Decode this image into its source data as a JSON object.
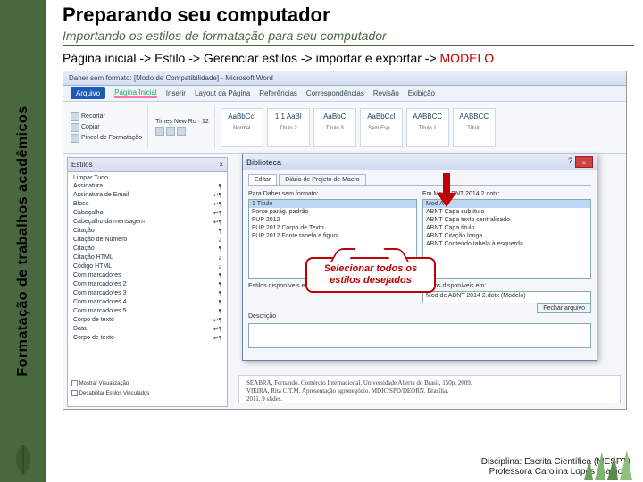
{
  "sidebar": {
    "vertical_text": "Formatação de trabalhos acadêmicos"
  },
  "header": {
    "title": "Preparando seu computador",
    "subtitle": "Importando os estilos de formatação para seu computador",
    "path_plain": "Página inicial -> Estilo -> Gerenciar estilos -> importar e exportar -> ",
    "path_red": "MODELO"
  },
  "word": {
    "window_title": "Daher sem formato: [Modo de Compatibilidade] - Microsoft Word",
    "file_tab": "Arquivo",
    "tabs": [
      "Página Inicial",
      "Inserir",
      "Layout da Página",
      "Referências",
      "Correspondências",
      "Revisão",
      "Exibição"
    ],
    "clipboard": {
      "cut": "Recortar",
      "copy": "Copiar",
      "brush": "Pincel de Formatação"
    },
    "font": "Times New Ro · 12",
    "style_samples": [
      {
        "a": "AaBbCcl",
        "b": "Normal"
      },
      {
        "a": "1.1 AaBl",
        "b": "Título 2"
      },
      {
        "a": "AaBbC",
        "b": "Título 3"
      },
      {
        "a": "AaBbCcl",
        "b": "Sem Esp..."
      },
      {
        "a": "AABBCC",
        "b": "Título 1"
      },
      {
        "a": "AABBCC",
        "b": "Título"
      }
    ]
  },
  "styles_pane": {
    "title": "Estilos",
    "items": [
      {
        "n": "Limpar Tudo",
        "m": ""
      },
      {
        "n": "Assinatura",
        "m": "¶"
      },
      {
        "n": "Assinatura de Email",
        "m": "↵¶"
      },
      {
        "n": "Bloco",
        "m": "↵¶"
      },
      {
        "n": "Cabeçalho",
        "m": "↵¶"
      },
      {
        "n": "Cabeçalho da mensagem",
        "m": "↵¶"
      },
      {
        "n": "Citação",
        "m": "¶"
      },
      {
        "n": "Citação de Número",
        "m": "a"
      },
      {
        "n": "Citação",
        "m": "¶"
      },
      {
        "n": "Citação HTML",
        "m": "a"
      },
      {
        "n": "Código HTML",
        "m": "a"
      },
      {
        "n": "Com marcadores",
        "m": "¶"
      },
      {
        "n": "Com marcadores 2",
        "m": "¶"
      },
      {
        "n": "Com marcadores 3",
        "m": "¶"
      },
      {
        "n": "Com marcadores 4",
        "m": "¶"
      },
      {
        "n": "Com marcadores 5",
        "m": "¶"
      },
      {
        "n": "Corpo de texto",
        "m": "↵¶"
      },
      {
        "n": "Data",
        "m": "↵¶"
      },
      {
        "n": "Corpo de texto",
        "m": "↵¶"
      }
    ],
    "show_preview": "Mostrar Visualização",
    "disable_linked": "Desabilitar Estilos Vinculados"
  },
  "dialog": {
    "title": "Biblioteca",
    "tab1": "Editar",
    "tab2": "Diário de Projeto de Macro",
    "left_label": "Para Daher sem formato:",
    "right_label": "Em Mod ABNT 2014 2.dotx:",
    "left_items": [
      "1 Título",
      "Fonte parág. padrão",
      "FUP 2012",
      "FUP 2012 Corpo de Texto",
      "FUP 2012 Fonte tabela e figura"
    ],
    "right_items": [
      "Mod A4",
      "ABNT Capa subtitulo",
      "ABNT Capa texto centralizado",
      "ABNT Capa título",
      "ABNT Citação longa",
      "ABNT Conteúdo tabela à esquerda"
    ],
    "avail_label": "Estilos disponíveis em:",
    "right_avail_label": "Estilos disponíveis em:",
    "right_file": "Mod de ABNT 2014 2.dotx (Modelo)",
    "close_file": "Fechar arquivo",
    "desc_label": "Descrição"
  },
  "doc_lines": [
    "SEABRA, Fernando. Comércio Internacional. Universidade Aberta do Brasil, 150p. 2009.",
    "VIEIRA, Rita C.T.M. Apresentação agronegócio. MDIC/SPD/DEORN. Brasília,",
    "2011. 9 slides."
  ],
  "callout": "Selecionar todos os estilos desejados",
  "footer": {
    "line1": "Disciplina: Escrita Científica (MESPT)",
    "line2": "Professora Carolina Lopes Araujo"
  },
  "icons": {
    "close": "×",
    "help": "?"
  }
}
